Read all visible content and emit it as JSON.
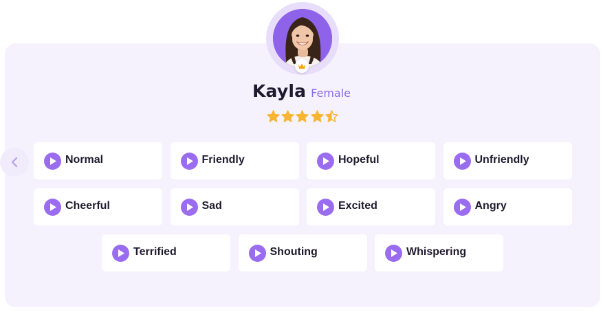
{
  "profile": {
    "name": "Kayla",
    "gender": "Female",
    "rating": 4.5,
    "rating_max": 5,
    "badge_icon": "crown-icon"
  },
  "colors": {
    "accent": "#9a6cf0",
    "panel_bg": "#f6f2fd",
    "star": "#f7b532",
    "text": "#1f1a2e",
    "gender_text": "#8a6be8"
  },
  "navigation": {
    "prev_icon": "chevron-left-icon"
  },
  "voices": [
    {
      "label": "Normal",
      "icon": "play-icon"
    },
    {
      "label": "Friendly",
      "icon": "play-icon"
    },
    {
      "label": "Hopeful",
      "icon": "play-icon"
    },
    {
      "label": "Unfriendly",
      "icon": "play-icon"
    },
    {
      "label": "Cheerful",
      "icon": "play-icon"
    },
    {
      "label": "Sad",
      "icon": "play-icon"
    },
    {
      "label": "Excited",
      "icon": "play-icon"
    },
    {
      "label": "Angry",
      "icon": "play-icon"
    },
    {
      "label": "Terrified",
      "icon": "play-icon"
    },
    {
      "label": "Shouting",
      "icon": "play-icon"
    },
    {
      "label": "Whispering",
      "icon": "play-icon"
    }
  ]
}
